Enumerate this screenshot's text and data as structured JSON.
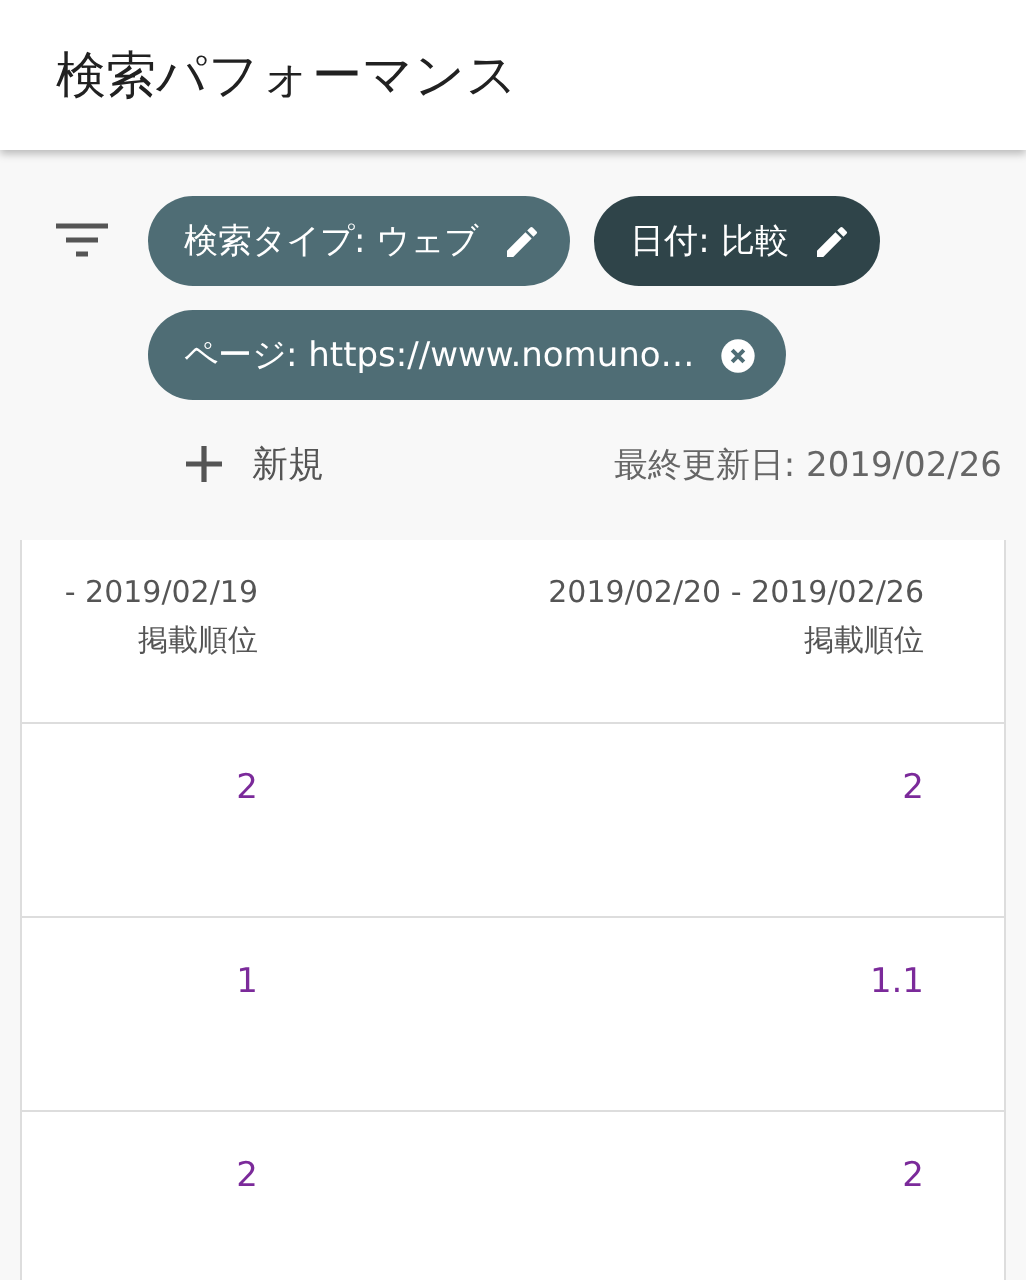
{
  "header": {
    "title": "検索パフォーマンス"
  },
  "filters": [
    {
      "label": "検索タイプ: ウェブ",
      "kind": "edit",
      "selected": false
    },
    {
      "label": "日付: 比較",
      "kind": "edit",
      "selected": true
    },
    {
      "label": "ページ: https://www.nomuno…",
      "kind": "remove",
      "selected": false
    }
  ],
  "new_button": {
    "label": "新規"
  },
  "last_updated": "最終更新日: 2019/02/26",
  "table": {
    "columns": [
      {
        "range": "- 2019/02/19",
        "metric": "掲載順位"
      },
      {
        "range": "2019/02/20 - 2019/02/26",
        "metric": "掲載順位"
      }
    ],
    "rows": [
      [
        "2",
        "2"
      ],
      [
        "1",
        "1.1"
      ],
      [
        "2",
        "2"
      ]
    ]
  }
}
